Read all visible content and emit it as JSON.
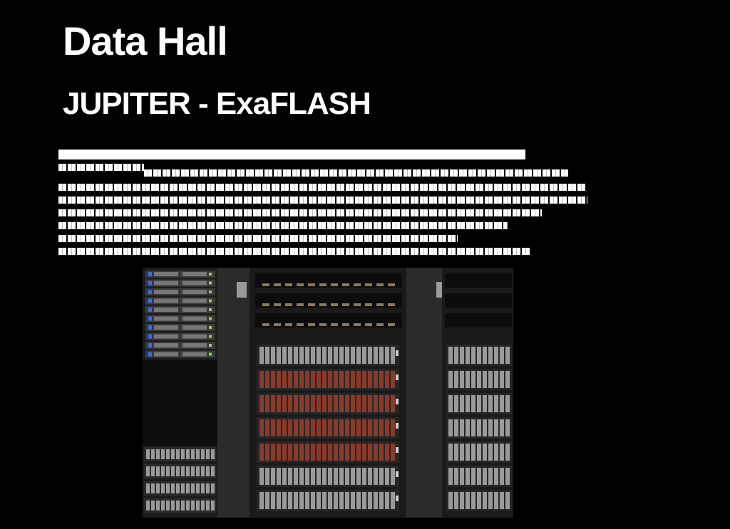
{
  "slide": {
    "title": "Data Hall",
    "subtitle": "JUPITER - ExaFLASH"
  },
  "description": {
    "lines": 8
  },
  "photo": {
    "subject": "storage rack image"
  },
  "colors": {
    "background": "#000000",
    "text": "#ffffff",
    "rack_frame": "#2b2b2b",
    "drive_face": "#9a9a9a",
    "led_blue": "#2f6bff",
    "led_green": "#8fd14f",
    "drive_glow": "#8a3a2a"
  }
}
